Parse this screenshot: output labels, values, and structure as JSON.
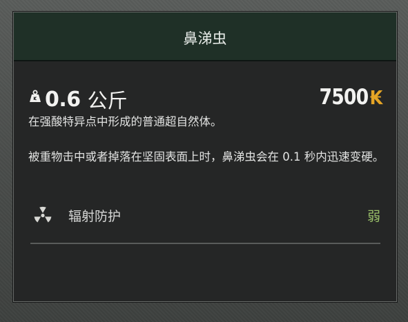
{
  "item": {
    "title": "鼻涕虫",
    "weight_value": "0.6",
    "weight_unit": "公斤",
    "price": "7500",
    "currency_symbol": "₭",
    "description_1": "在强酸特异点中形成的普通超自然体。",
    "description_2": "被重物击中或者掉落在坚固表面上时，鼻涕虫会在 0.1 秒内迅速变硬。"
  },
  "stats": [
    {
      "label": "辐射防护",
      "value": "弱",
      "icon": "radiation-icon"
    }
  ],
  "colors": {
    "header_bg": "#1f3027",
    "panel_bg": "#252626",
    "currency": "#e6a525",
    "stat_value": "#9bc26a"
  },
  "icons": {
    "weight": "weight-icon",
    "radiation": "radiation-icon"
  }
}
